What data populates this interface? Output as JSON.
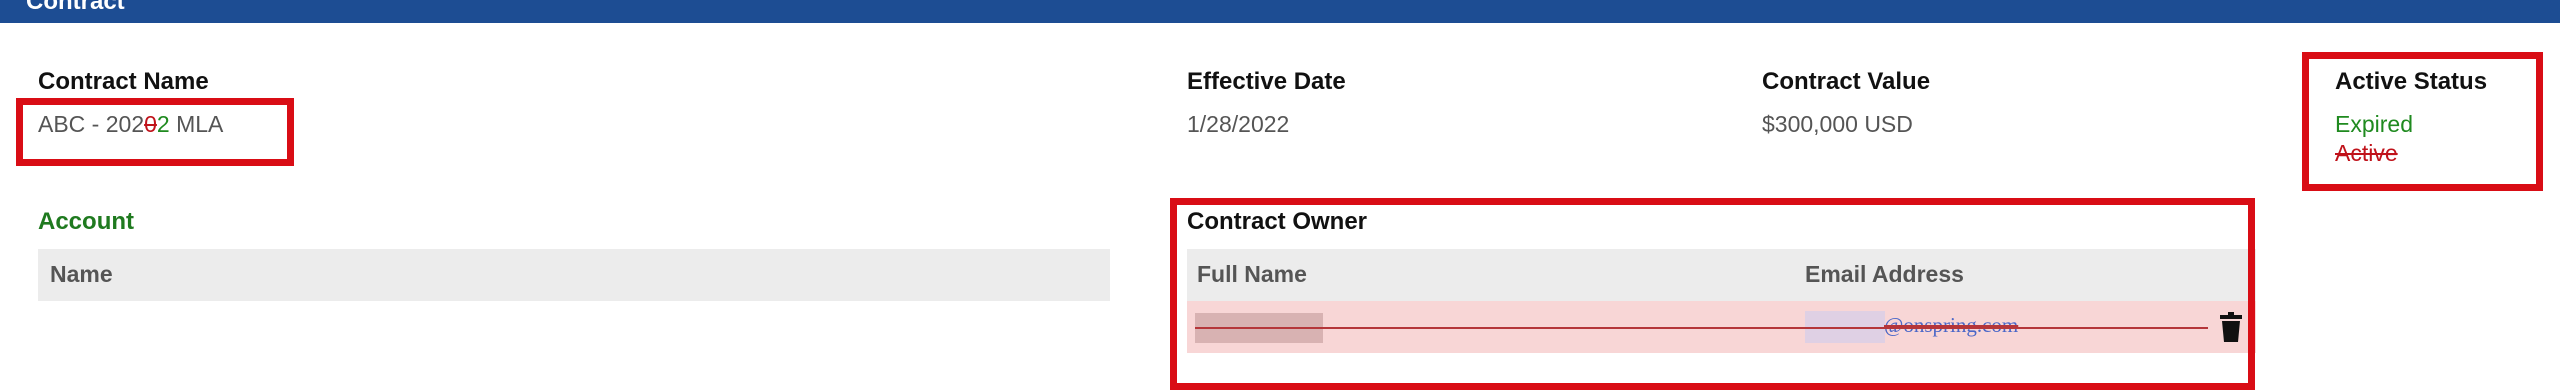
{
  "header": {
    "title": "Contract"
  },
  "contract_name": {
    "label": "Contract Name",
    "value_prefix": "ABC - 202",
    "value_deleted": "0",
    "value_inserted": "2",
    "value_suffix": " MLA"
  },
  "effective_date": {
    "label": "Effective Date",
    "value": "1/28/2022"
  },
  "contract_value": {
    "label": "Contract Value",
    "value": "$300,000 USD"
  },
  "active_status": {
    "label": "Active Status",
    "new_value": "Expired",
    "old_value": "Active"
  },
  "account": {
    "label": "Account",
    "columns": [
      "Name"
    ]
  },
  "contract_owner": {
    "label": "Contract Owner",
    "columns": [
      "Full Name",
      "Email Address"
    ],
    "rows": [
      {
        "email_visible": "@onspring.com"
      }
    ]
  },
  "icons": {
    "delete": "trash-icon"
  },
  "colors": {
    "header_bar": "#1d4d93",
    "annotation_box": "#d90d15",
    "added_text": "#1f8a1f",
    "removed_text": "#c0121a",
    "removed_row_bg": "#f8d6d6"
  }
}
